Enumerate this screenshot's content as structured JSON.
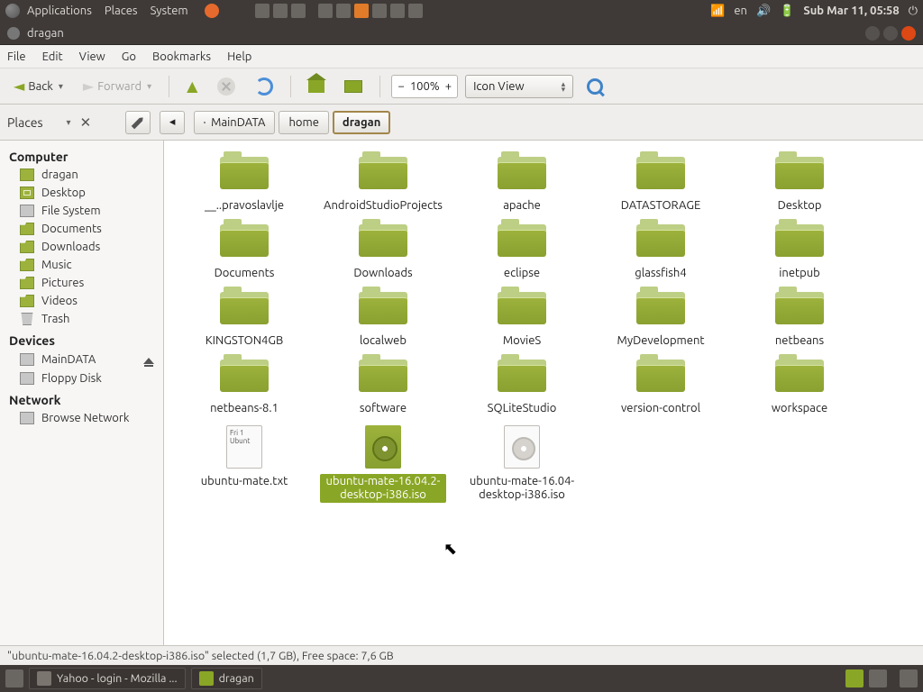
{
  "panel": {
    "menus": [
      "Applications",
      "Places",
      "System"
    ],
    "lang": "en",
    "clock": "Sub Mar 11, 05:58"
  },
  "window": {
    "title": "dragan",
    "menu": [
      "File",
      "Edit",
      "View",
      "Go",
      "Bookmarks",
      "Help"
    ],
    "back": "Back",
    "forward": "Forward",
    "zoom": "100%",
    "view_mode": "Icon View",
    "places_label": "Places",
    "breadcrumbs": [
      {
        "label": "MainDATA",
        "icon": "drive"
      },
      {
        "label": "home"
      },
      {
        "label": "dragan",
        "active": true
      }
    ],
    "status": "\"ubuntu-mate-16.04.2-desktop-i386.iso\" selected (1,7 GB), Free space: 7,6 GB"
  },
  "sidebar": {
    "groups": [
      {
        "title": "Computer",
        "items": [
          {
            "label": "dragan",
            "icon": "home"
          },
          {
            "label": "Desktop",
            "icon": "desk"
          },
          {
            "label": "File System",
            "icon": "drive"
          },
          {
            "label": "Documents",
            "icon": "folder"
          },
          {
            "label": "Downloads",
            "icon": "folder"
          },
          {
            "label": "Music",
            "icon": "folder"
          },
          {
            "label": "Pictures",
            "icon": "folder"
          },
          {
            "label": "Videos",
            "icon": "folder"
          },
          {
            "label": "Trash",
            "icon": "trash"
          }
        ]
      },
      {
        "title": "Devices",
        "items": [
          {
            "label": "MainDATA",
            "icon": "drive",
            "eject": true
          },
          {
            "label": "Floppy Disk",
            "icon": "drive"
          }
        ]
      },
      {
        "title": "Network",
        "items": [
          {
            "label": "Browse Network",
            "icon": "net"
          }
        ]
      }
    ]
  },
  "files": [
    {
      "name": "__..pravoslavlje",
      "type": "folder"
    },
    {
      "name": "AndroidStudioProjects",
      "type": "folder"
    },
    {
      "name": "apache",
      "type": "folder"
    },
    {
      "name": "DATASTORAGE",
      "type": "folder"
    },
    {
      "name": "Desktop",
      "type": "folder"
    },
    {
      "name": "Documents",
      "type": "folder"
    },
    {
      "name": "Downloads",
      "type": "folder"
    },
    {
      "name": "eclipse",
      "type": "folder"
    },
    {
      "name": "glassfish4",
      "type": "folder"
    },
    {
      "name": "inetpub",
      "type": "folder"
    },
    {
      "name": "KINGSTON4GB",
      "type": "folder"
    },
    {
      "name": "localweb",
      "type": "folder"
    },
    {
      "name": "MovieS",
      "type": "folder"
    },
    {
      "name": "MyDevelopment",
      "type": "folder"
    },
    {
      "name": "netbeans",
      "type": "folder"
    },
    {
      "name": "netbeans-8.1",
      "type": "folder"
    },
    {
      "name": "software",
      "type": "folder"
    },
    {
      "name": "SQLiteStudio",
      "type": "folder"
    },
    {
      "name": "version-control",
      "type": "folder"
    },
    {
      "name": "workspace",
      "type": "folder"
    },
    {
      "name": "ubuntu-mate.txt",
      "type": "text",
      "preview": "Fri 1\nUbunt"
    },
    {
      "name": "ubuntu-mate-16.04.2-desktop-i386.iso",
      "type": "iso",
      "selected": true
    },
    {
      "name": "ubuntu-mate-16.04-desktop-i386.iso",
      "type": "iso-plain"
    }
  ],
  "taskbar": {
    "items": [
      {
        "label": "Yahoo - login - Mozilla ...",
        "icon": "firefox"
      },
      {
        "label": "dragan",
        "icon": "files",
        "active": true
      }
    ]
  }
}
